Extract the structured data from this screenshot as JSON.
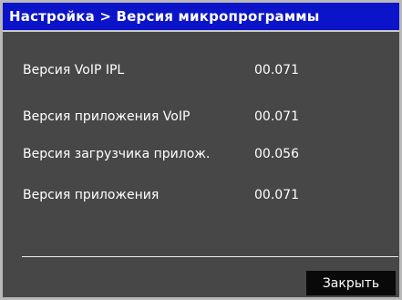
{
  "title_bar": {
    "title": "Настройка > Версия микропрограммы"
  },
  "versions": [
    {
      "label": "Версия VoIP IPL",
      "value": "00.071"
    },
    {
      "label": "Версия приложения VoIP",
      "value": "00.071"
    },
    {
      "label": "Версия загрузчика прилож.",
      "value": "00.056"
    },
    {
      "label": "Версия приложения",
      "value": "00.071"
    }
  ],
  "footer": {
    "close_label": "Закрыть"
  },
  "colors": {
    "title_bar_bg": "#0b14c8",
    "panel_bg": "#474747",
    "frame_border": "#b9b9b9",
    "button_bg": "#090909",
    "text": "#ffffff"
  }
}
